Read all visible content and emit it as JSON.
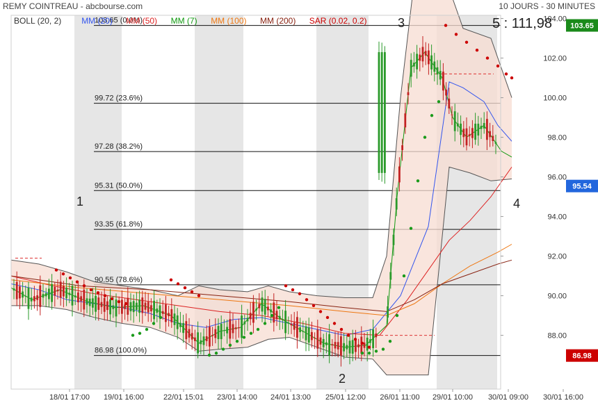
{
  "header": {
    "title": "REMY COINTREAU - abcbourse.com",
    "period": "10 JOURS - 30 MINUTES"
  },
  "legend": [
    {
      "label": "BOLL (20, 2)",
      "color": "#333333"
    },
    {
      "label": "MM (20)",
      "color": "#3355ee"
    },
    {
      "label": "MM (50)",
      "color": "#dd2222"
    },
    {
      "label": "MM (7)",
      "color": "#119911"
    },
    {
      "label": "MM (100)",
      "color": "#ee7711"
    },
    {
      "label": "MM (200)",
      "color": "#882211"
    },
    {
      "label": "SAR (0.02, 0.2)",
      "color": "#cc0000"
    }
  ],
  "annotation_text": "5 : 111,98",
  "markers": [
    "1",
    "2",
    "3",
    "4"
  ],
  "chart_data": {
    "type": "line",
    "ylim": [
      86,
      104.4
    ],
    "yticks": [
      "104.00",
      "102.00",
      "100.00",
      "98.00",
      "96.00",
      "94.00",
      "92.00",
      "90.00",
      "88.00"
    ],
    "xticks": [
      "18/01 17:00",
      "19/01 16:00",
      "22/01 15:01",
      "23/01 14:00",
      "24/01 13:00",
      "25/01 12:00",
      "26/01 11:00",
      "29/01 10:00",
      "30/01 09:00",
      "30/01 16:00"
    ],
    "fibonacci": [
      {
        "label": "103.65  (0.0%)",
        "value": 103.65
      },
      {
        "label": "99.72  (23.6%)",
        "value": 99.72
      },
      {
        "label": "97.28  (38.2%)",
        "value": 97.28
      },
      {
        "label": "95.31  (50.0%)",
        "value": 95.31
      },
      {
        "label": "93.35  (61.8%)",
        "value": 93.35
      },
      {
        "label": "90.55  (78.6%)",
        "value": 90.55
      },
      {
        "label": "86.98  (100.0%)",
        "value": 86.98
      }
    ],
    "price_tags": [
      {
        "label": "103.65",
        "value": 103.65,
        "color": "#1a8a1a"
      },
      {
        "label": "95.54",
        "value": 95.54,
        "color": "#2266dd"
      },
      {
        "label": "86.98",
        "value": 86.98,
        "color": "#cc0000"
      }
    ],
    "series": [
      {
        "name": "MM (20)",
        "color": "#3355ee",
        "values": [
          [
            0,
            90.6
          ],
          [
            40,
            90.3
          ],
          [
            80,
            89.8
          ],
          [
            120,
            89.6
          ],
          [
            160,
            89.4
          ],
          [
            200,
            89.1
          ],
          [
            240,
            88.6
          ],
          [
            280,
            88.4
          ],
          [
            320,
            88.8
          ],
          [
            360,
            88.9
          ],
          [
            400,
            88.6
          ],
          [
            440,
            88.3
          ],
          [
            480,
            88.0
          ],
          [
            520,
            88.3
          ],
          [
            560,
            90.0
          ],
          [
            600,
            93.5
          ],
          [
            630,
            100.8
          ],
          [
            650,
            100.5
          ],
          [
            680,
            99.8
          ],
          [
            700,
            98.6
          ],
          [
            720,
            97.8
          ]
        ]
      },
      {
        "name": "MM (7)",
        "color": "#119911",
        "values": [
          [
            0,
            90.4
          ],
          [
            30,
            89.8
          ],
          [
            70,
            90.3
          ],
          [
            110,
            89.7
          ],
          [
            150,
            89.4
          ],
          [
            190,
            89.5
          ],
          [
            230,
            89.0
          ],
          [
            270,
            87.6
          ],
          [
            300,
            88.2
          ],
          [
            330,
            88.4
          ],
          [
            360,
            89.6
          ],
          [
            390,
            88.8
          ],
          [
            420,
            88.2
          ],
          [
            450,
            87.6
          ],
          [
            480,
            87.4
          ],
          [
            510,
            87.5
          ],
          [
            540,
            88.5
          ],
          [
            555,
            95.0
          ],
          [
            575,
            101.5
          ],
          [
            595,
            102.3
          ],
          [
            620,
            101.0
          ],
          [
            635,
            99.0
          ],
          [
            655,
            98.0
          ],
          [
            680,
            98.6
          ],
          [
            705,
            97.3
          ],
          [
            720,
            97.0
          ]
        ]
      },
      {
        "name": "MM (50)",
        "color": "#dd2222",
        "values": [
          [
            0,
            91.0
          ],
          [
            60,
            90.5
          ],
          [
            120,
            90.1
          ],
          [
            180,
            89.8
          ],
          [
            240,
            89.5
          ],
          [
            300,
            89.2
          ],
          [
            360,
            89.0
          ],
          [
            420,
            88.6
          ],
          [
            480,
            88.1
          ],
          [
            530,
            88.0
          ],
          [
            570,
            89.8
          ],
          [
            600,
            91.3
          ],
          [
            630,
            92.8
          ],
          [
            660,
            93.8
          ],
          [
            690,
            95.0
          ],
          [
            720,
            96.5
          ]
        ]
      },
      {
        "name": "MM (100)",
        "color": "#ee7711",
        "values": [
          [
            0,
            90.8
          ],
          [
            100,
            90.4
          ],
          [
            200,
            90.1
          ],
          [
            300,
            89.8
          ],
          [
            400,
            89.5
          ],
          [
            480,
            89.2
          ],
          [
            540,
            89.0
          ],
          [
            580,
            89.6
          ],
          [
            620,
            90.6
          ],
          [
            660,
            91.5
          ],
          [
            700,
            92.2
          ],
          [
            720,
            92.6
          ]
        ]
      },
      {
        "name": "MM (200)",
        "color": "#882211",
        "values": [
          [
            0,
            91.0
          ],
          [
            100,
            90.5
          ],
          [
            200,
            90.3
          ],
          [
            300,
            90.0
          ],
          [
            400,
            89.7
          ],
          [
            480,
            89.4
          ],
          [
            540,
            89.2
          ],
          [
            580,
            89.8
          ],
          [
            620,
            90.6
          ],
          [
            660,
            91.1
          ],
          [
            700,
            91.6
          ],
          [
            720,
            91.8
          ]
        ]
      }
    ],
    "bollinger": {
      "upper": [
        [
          0,
          91.8
        ],
        [
          40,
          91.6
        ],
        [
          80,
          91.2
        ],
        [
          120,
          90.7
        ],
        [
          160,
          90.5
        ],
        [
          200,
          90.3
        ],
        [
          240,
          90.0
        ],
        [
          270,
          90.5
        ],
        [
          300,
          90.3
        ],
        [
          340,
          90.2
        ],
        [
          370,
          90.5
        ],
        [
          400,
          90.2
        ],
        [
          440,
          90.0
        ],
        [
          480,
          89.9
        ],
        [
          520,
          89.9
        ],
        [
          540,
          92.0
        ],
        [
          560,
          100.0
        ],
        [
          580,
          106.0
        ],
        [
          620,
          106.5
        ],
        [
          650,
          103.5
        ],
        [
          690,
          103.0
        ],
        [
          720,
          100.0
        ]
      ],
      "lower": [
        [
          0,
          89.5
        ],
        [
          40,
          89.5
        ],
        [
          80,
          89.3
        ],
        [
          120,
          88.9
        ],
        [
          160,
          88.6
        ],
        [
          200,
          88.4
        ],
        [
          240,
          87.9
        ],
        [
          270,
          87.2
        ],
        [
          300,
          87.3
        ],
        [
          340,
          87.4
        ],
        [
          370,
          87.8
        ],
        [
          400,
          87.9
        ],
        [
          440,
          87.4
        ],
        [
          480,
          86.9
        ],
        [
          520,
          86.8
        ],
        [
          540,
          86.0
        ],
        [
          600,
          86.0
        ],
        [
          630,
          96.5
        ],
        [
          660,
          96.2
        ],
        [
          690,
          95.8
        ],
        [
          720,
          95.9
        ]
      ]
    },
    "sar": {
      "color": "#cc0000",
      "upper": [
        [
          65,
          91.3
        ],
        [
          75,
          91.1
        ],
        [
          85,
          90.9
        ],
        [
          95,
          90.7
        ],
        [
          105,
          90.5
        ],
        [
          115,
          90.3
        ],
        [
          125,
          90.15
        ],
        [
          135,
          90.0
        ],
        [
          145,
          89.85
        ],
        [
          155,
          89.7
        ],
        [
          165,
          89.6
        ],
        [
          230,
          90.8
        ],
        [
          240,
          90.6
        ],
        [
          250,
          90.4
        ],
        [
          260,
          90.2
        ],
        [
          270,
          90.0
        ],
        [
          395,
          90.5
        ],
        [
          405,
          90.3
        ],
        [
          415,
          90.1
        ],
        [
          425,
          89.8
        ],
        [
          435,
          89.5
        ],
        [
          445,
          89.2
        ],
        [
          455,
          88.9
        ],
        [
          465,
          88.6
        ],
        [
          475,
          88.3
        ],
        [
          485,
          88.0
        ],
        [
          495,
          87.8
        ],
        [
          505,
          87.6
        ],
        [
          515,
          87.4
        ],
        [
          625,
          103.65
        ],
        [
          640,
          103.2
        ],
        [
          655,
          102.8
        ],
        [
          670,
          102.4
        ],
        [
          685,
          102.0
        ],
        [
          700,
          101.6
        ],
        [
          712,
          101.2
        ],
        [
          720,
          101.0
        ]
      ],
      "lower": [
        [
          175,
          88.0
        ],
        [
          185,
          88.1
        ],
        [
          195,
          88.3
        ],
        [
          205,
          88.6
        ],
        [
          215,
          88.9
        ],
        [
          285,
          87.0
        ],
        [
          295,
          87.1
        ],
        [
          305,
          87.3
        ],
        [
          315,
          87.5
        ],
        [
          325,
          87.7
        ],
        [
          335,
          87.9
        ],
        [
          345,
          88.1
        ],
        [
          355,
          88.3
        ],
        [
          365,
          88.6
        ],
        [
          375,
          89.0
        ],
        [
          385,
          89.4
        ],
        [
          505,
          87.1
        ],
        [
          515,
          87.1
        ],
        [
          525,
          87.2
        ],
        [
          535,
          87.3
        ],
        [
          545,
          87.7
        ],
        [
          555,
          89.0
        ],
        [
          565,
          91.0
        ],
        [
          575,
          93.4
        ],
        [
          585,
          95.8
        ],
        [
          595,
          98.0
        ],
        [
          605,
          99.1
        ],
        [
          615,
          99.8
        ]
      ]
    }
  }
}
